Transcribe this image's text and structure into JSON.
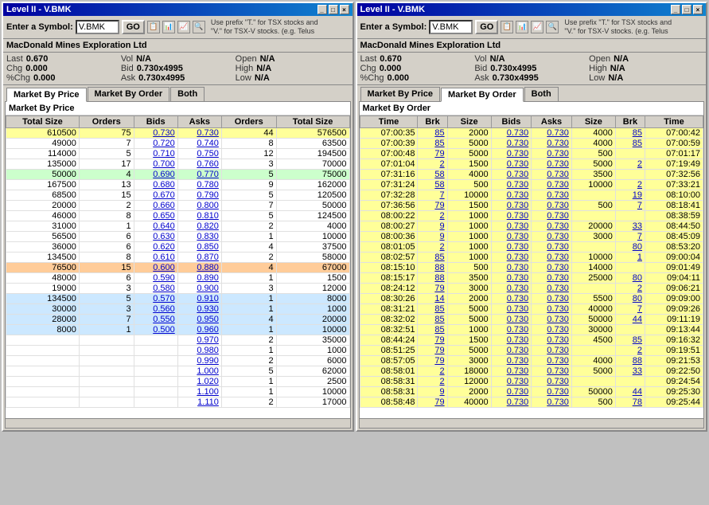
{
  "windows": [
    {
      "id": "left-window",
      "title": "Level II - V.BMK",
      "symbol": "V.BMK",
      "company": "MacDonald Mines Exploration Ltd",
      "stock": {
        "last": "0.670",
        "chg": "0.000",
        "pct_chg": "0.000",
        "vol": "N/A",
        "bid": "0.730x4995",
        "ask": "0.730x4995",
        "open": "N/A",
        "high": "N/A",
        "low": "N/A"
      },
      "active_tab": "Market By Price",
      "tabs": [
        "Market By Price",
        "Market By Order",
        "Both"
      ],
      "section_title": "Market By Price",
      "table_headers": [
        "Total Size",
        "Orders",
        "Bids",
        "Asks",
        "Orders",
        "Total Size"
      ],
      "rows": [
        {
          "total_size_l": "610500",
          "orders_l": "75",
          "bid": "0.730",
          "ask": "0.730",
          "orders_r": "44",
          "total_size_r": "576500",
          "color": "yellow"
        },
        {
          "total_size_l": "49000",
          "orders_l": "7",
          "bid": "0.720",
          "ask": "0.740",
          "orders_r": "8",
          "total_size_r": "63500",
          "color": "default"
        },
        {
          "total_size_l": "114000",
          "orders_l": "5",
          "bid": "0.710",
          "ask": "0.750",
          "orders_r": "12",
          "total_size_r": "194500",
          "color": "default"
        },
        {
          "total_size_l": "135000",
          "orders_l": "17",
          "bid": "0.700",
          "ask": "0.760",
          "orders_r": "3",
          "total_size_r": "70000",
          "color": "default"
        },
        {
          "total_size_l": "50000",
          "orders_l": "4",
          "bid": "0.690",
          "ask": "0.770",
          "orders_r": "5",
          "total_size_r": "75000",
          "color": "green"
        },
        {
          "total_size_l": "167500",
          "orders_l": "13",
          "bid": "0.680",
          "ask": "0.780",
          "orders_r": "9",
          "total_size_r": "162000",
          "color": "default"
        },
        {
          "total_size_l": "68500",
          "orders_l": "15",
          "bid": "0.670",
          "ask": "0.790",
          "orders_r": "5",
          "total_size_r": "120500",
          "color": "default"
        },
        {
          "total_size_l": "20000",
          "orders_l": "2",
          "bid": "0.660",
          "ask": "0.800",
          "orders_r": "7",
          "total_size_r": "50000",
          "color": "default"
        },
        {
          "total_size_l": "46000",
          "orders_l": "8",
          "bid": "0.650",
          "ask": "0.810",
          "orders_r": "5",
          "total_size_r": "124500",
          "color": "default"
        },
        {
          "total_size_l": "31000",
          "orders_l": "1",
          "bid": "0.640",
          "ask": "0.820",
          "orders_r": "2",
          "total_size_r": "4000",
          "color": "default"
        },
        {
          "total_size_l": "56500",
          "orders_l": "6",
          "bid": "0.630",
          "ask": "0.830",
          "orders_r": "1",
          "total_size_r": "10000",
          "color": "default"
        },
        {
          "total_size_l": "36000",
          "orders_l": "6",
          "bid": "0.620",
          "ask": "0.850",
          "orders_r": "4",
          "total_size_r": "37500",
          "color": "default"
        },
        {
          "total_size_l": "134500",
          "orders_l": "8",
          "bid": "0.610",
          "ask": "0.870",
          "orders_r": "2",
          "total_size_r": "58000",
          "color": "default"
        },
        {
          "total_size_l": "76500",
          "orders_l": "15",
          "bid": "0.600",
          "ask": "0.880",
          "orders_r": "4",
          "total_size_r": "67000",
          "color": "orange"
        },
        {
          "total_size_l": "48000",
          "orders_l": "6",
          "bid": "0.590",
          "ask": "0.890",
          "orders_r": "1",
          "total_size_r": "1500",
          "color": "default"
        },
        {
          "total_size_l": "19000",
          "orders_l": "3",
          "bid": "0.580",
          "ask": "0.900",
          "orders_r": "3",
          "total_size_r": "12000",
          "color": "default"
        },
        {
          "total_size_l": "134500",
          "orders_l": "5",
          "bid": "0.570",
          "ask": "0.910",
          "orders_r": "1",
          "total_size_r": "8000",
          "color": "blue"
        },
        {
          "total_size_l": "30000",
          "orders_l": "3",
          "bid": "0.560",
          "ask": "0.930",
          "orders_r": "1",
          "total_size_r": "1000",
          "color": "blue"
        },
        {
          "total_size_l": "28000",
          "orders_l": "7",
          "bid": "0.550",
          "ask": "0.950",
          "orders_r": "4",
          "total_size_r": "20000",
          "color": "blue"
        },
        {
          "total_size_l": "8000",
          "orders_l": "1",
          "bid": "0.500",
          "ask": "0.960",
          "orders_r": "1",
          "total_size_r": "10000",
          "color": "blue"
        },
        {
          "total_size_l": "",
          "orders_l": "",
          "bid": "",
          "ask": "0.970",
          "orders_r": "2",
          "total_size_r": "35000",
          "color": "default"
        },
        {
          "total_size_l": "",
          "orders_l": "",
          "bid": "",
          "ask": "0.980",
          "orders_r": "1",
          "total_size_r": "1000",
          "color": "default"
        },
        {
          "total_size_l": "",
          "orders_l": "",
          "bid": "",
          "ask": "0.990",
          "orders_r": "2",
          "total_size_r": "6000",
          "color": "default"
        },
        {
          "total_size_l": "",
          "orders_l": "",
          "bid": "",
          "ask": "1.000",
          "orders_r": "5",
          "total_size_r": "62000",
          "color": "default"
        },
        {
          "total_size_l": "",
          "orders_l": "",
          "bid": "",
          "ask": "1.020",
          "orders_r": "1",
          "total_size_r": "2500",
          "color": "default"
        },
        {
          "total_size_l": "",
          "orders_l": "",
          "bid": "",
          "ask": "1.100",
          "orders_r": "1",
          "total_size_r": "10000",
          "color": "default"
        },
        {
          "total_size_l": "",
          "orders_l": "",
          "bid": "",
          "ask": "1.110",
          "orders_r": "2",
          "total_size_r": "17000",
          "color": "default"
        }
      ]
    },
    {
      "id": "right-window",
      "title": "Level II - V.BMK",
      "symbol": "V.BMK",
      "company": "MacDonald Mines Exploration Ltd",
      "stock": {
        "last": "0.670",
        "chg": "0.000",
        "pct_chg": "0.000",
        "vol": "N/A",
        "bid": "0.730x4995",
        "ask": "0.730x4995",
        "open": "N/A",
        "high": "N/A",
        "low": "N/A"
      },
      "active_tab": "Market By Order",
      "tabs": [
        "Market By Price",
        "Market By Order",
        "Both"
      ],
      "section_title": "Market By Order",
      "table_headers": [
        "Time",
        "Brk",
        "Size",
        "Bids",
        "Asks",
        "Size",
        "Brk",
        "Time"
      ],
      "rows": [
        {
          "time_l": "07:00:35",
          "brk_l": "85",
          "size_l": "2000",
          "bid": "0.730",
          "ask": "0.730",
          "size_r": "4000",
          "brk_r": "85",
          "time_r": "07:00:42",
          "color": "yellow"
        },
        {
          "time_l": "07:00:39",
          "brk_l": "85",
          "size_l": "5000",
          "bid": "0.730",
          "ask": "0.730",
          "size_r": "4000",
          "brk_r": "85",
          "time_r": "07:00:59",
          "color": "yellow"
        },
        {
          "time_l": "07:00:48",
          "brk_l": "79",
          "size_l": "5000",
          "bid": "0.730",
          "ask": "0.730",
          "size_r": "500",
          "brk_r": "",
          "time_r": "07:01:17",
          "color": "yellow"
        },
        {
          "time_l": "07:01:04",
          "brk_l": "2",
          "size_l": "1500",
          "bid": "0.730",
          "ask": "0.730",
          "size_r": "5000",
          "brk_r": "2",
          "time_r": "07:19:49",
          "color": "yellow"
        },
        {
          "time_l": "07:31:16",
          "brk_l": "58",
          "size_l": "4000",
          "bid": "0.730",
          "ask": "0.730",
          "size_r": "3500",
          "brk_r": "",
          "time_r": "07:32:56",
          "color": "yellow"
        },
        {
          "time_l": "07:31:24",
          "brk_l": "58",
          "size_l": "500",
          "bid": "0.730",
          "ask": "0.730",
          "size_r": "10000",
          "brk_r": "2",
          "time_r": "07:33:21",
          "color": "yellow"
        },
        {
          "time_l": "07:32:28",
          "brk_l": "7",
          "size_l": "10000",
          "bid": "0.730",
          "ask": "0.730",
          "size_r": "",
          "brk_r": "19",
          "time_r": "08:10:00",
          "color": "yellow"
        },
        {
          "time_l": "07:36:56",
          "brk_l": "79",
          "size_l": "1500",
          "bid": "0.730",
          "ask": "0.730",
          "size_r": "500",
          "brk_r": "7",
          "time_r": "08:18:41",
          "color": "yellow"
        },
        {
          "time_l": "08:00:22",
          "brk_l": "2",
          "size_l": "1000",
          "bid": "0.730",
          "ask": "0.730",
          "size_r": "",
          "brk_r": "",
          "time_r": "08:38:59",
          "color": "yellow"
        },
        {
          "time_l": "08:00:27",
          "brk_l": "9",
          "size_l": "1000",
          "bid": "0.730",
          "ask": "0.730",
          "size_r": "20000",
          "brk_r": "33",
          "time_r": "08:44:50",
          "color": "yellow"
        },
        {
          "time_l": "08:00:36",
          "brk_l": "9",
          "size_l": "1000",
          "bid": "0.730",
          "ask": "0.730",
          "size_r": "3000",
          "brk_r": "7",
          "time_r": "08:45:09",
          "color": "yellow"
        },
        {
          "time_l": "08:01:05",
          "brk_l": "2",
          "size_l": "1000",
          "bid": "0.730",
          "ask": "0.730",
          "size_r": "",
          "brk_r": "80",
          "time_r": "08:53:20",
          "color": "yellow"
        },
        {
          "time_l": "08:02:57",
          "brk_l": "85",
          "size_l": "1000",
          "bid": "0.730",
          "ask": "0.730",
          "size_r": "10000",
          "brk_r": "1",
          "time_r": "09:00:04",
          "color": "yellow"
        },
        {
          "time_l": "08:15:10",
          "brk_l": "88",
          "size_l": "500",
          "bid": "0.730",
          "ask": "0.730",
          "size_r": "14000",
          "brk_r": "",
          "time_r": "09:01:49",
          "color": "yellow"
        },
        {
          "time_l": "08:15:17",
          "brk_l": "88",
          "size_l": "3500",
          "bid": "0.730",
          "ask": "0.730",
          "size_r": "25000",
          "brk_r": "80",
          "time_r": "09:04:11",
          "color": "yellow"
        },
        {
          "time_l": "08:24:12",
          "brk_l": "79",
          "size_l": "3000",
          "bid": "0.730",
          "ask": "0.730",
          "size_r": "",
          "brk_r": "2",
          "time_r": "09:06:21",
          "color": "yellow"
        },
        {
          "time_l": "08:30:26",
          "brk_l": "14",
          "size_l": "2000",
          "bid": "0.730",
          "ask": "0.730",
          "size_r": "5500",
          "brk_r": "80",
          "time_r": "09:09:00",
          "color": "yellow"
        },
        {
          "time_l": "08:31:21",
          "brk_l": "85",
          "size_l": "5000",
          "bid": "0.730",
          "ask": "0.730",
          "size_r": "40000",
          "brk_r": "7",
          "time_r": "09:09:26",
          "color": "yellow"
        },
        {
          "time_l": "08:32:02",
          "brk_l": "85",
          "size_l": "5000",
          "bid": "0.730",
          "ask": "0.730",
          "size_r": "50000",
          "brk_r": "44",
          "time_r": "09:11:19",
          "color": "yellow"
        },
        {
          "time_l": "08:32:51",
          "brk_l": "85",
          "size_l": "1000",
          "bid": "0.730",
          "ask": "0.730",
          "size_r": "30000",
          "brk_r": "",
          "time_r": "09:13:44",
          "color": "yellow"
        },
        {
          "time_l": "08:44:24",
          "brk_l": "79",
          "size_l": "1500",
          "bid": "0.730",
          "ask": "0.730",
          "size_r": "4500",
          "brk_r": "85",
          "time_r": "09:16:32",
          "color": "yellow"
        },
        {
          "time_l": "08:51:25",
          "brk_l": "79",
          "size_l": "5000",
          "bid": "0.730",
          "ask": "0.730",
          "size_r": "",
          "brk_r": "2",
          "time_r": "09:19:51",
          "color": "yellow"
        },
        {
          "time_l": "08:57:05",
          "brk_l": "79",
          "size_l": "3000",
          "bid": "0.730",
          "ask": "0.730",
          "size_r": "4000",
          "brk_r": "88",
          "time_r": "09:21:53",
          "color": "yellow"
        },
        {
          "time_l": "08:58:01",
          "brk_l": "2",
          "size_l": "18000",
          "bid": "0.730",
          "ask": "0.730",
          "size_r": "5000",
          "brk_r": "33",
          "time_r": "09:22:50",
          "color": "yellow"
        },
        {
          "time_l": "08:58:31",
          "brk_l": "2",
          "size_l": "12000",
          "bid": "0.730",
          "ask": "0.730",
          "size_r": "",
          "brk_r": "",
          "time_r": "09:24:54",
          "color": "yellow"
        },
        {
          "time_l": "08:58:31",
          "brk_l": "9",
          "size_l": "2000",
          "bid": "0.730",
          "ask": "0.730",
          "size_r": "50000",
          "brk_r": "44",
          "time_r": "09:25:30",
          "color": "yellow"
        },
        {
          "time_l": "08:58:48",
          "brk_l": "79",
          "size_l": "40000",
          "bid": "0.730",
          "ask": "0.730",
          "size_r": "500",
          "brk_r": "78",
          "time_r": "09:25:44",
          "color": "yellow"
        }
      ]
    }
  ],
  "toolbar": {
    "symbol_label": "Enter a Symbol:",
    "go_label": "GO",
    "hint": "Use prefix \"T.\" for TSX stocks and\n\"V.\" for TSX-V stocks. (e.g. Telus"
  }
}
